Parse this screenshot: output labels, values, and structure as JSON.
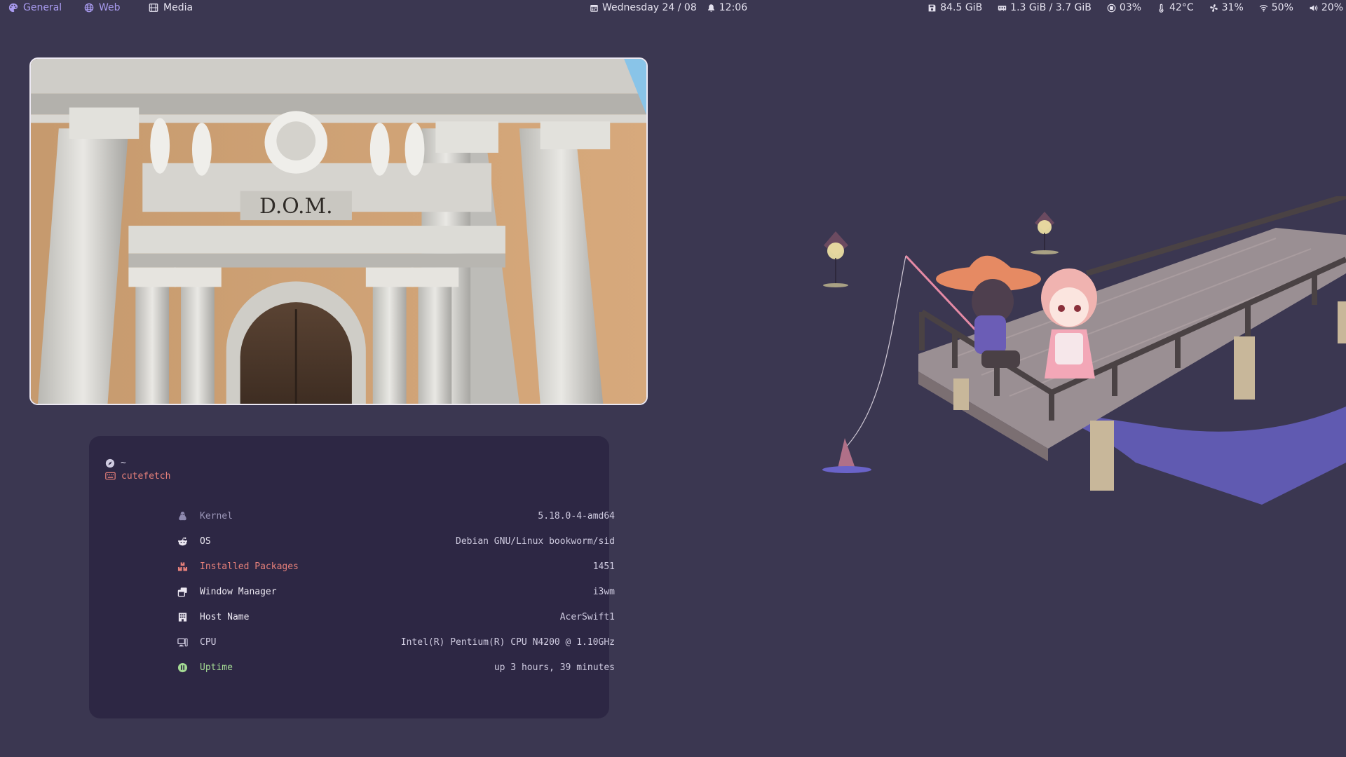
{
  "topbar": {
    "workspaces": [
      {
        "label": "General",
        "icon": "palette-icon",
        "active": true
      },
      {
        "label": "Web",
        "icon": "globe-icon",
        "active": true
      },
      {
        "label": "Media",
        "icon": "film-icon",
        "active": false
      }
    ],
    "date": "Wednesday 24 / 08",
    "time": "12:06",
    "disk": "84.5 GiB",
    "memory": "1.3 GiB / 3.7 GiB",
    "cpu": "03%",
    "temperature": "42°C",
    "fan": "31%",
    "wifi": "50%",
    "volume": "20%"
  },
  "terminal": {
    "directory": "~",
    "command": "cutefetch",
    "rows": [
      {
        "key": "Kernel",
        "value": "5.18.0-4-amd64",
        "icon": "linux-icon"
      },
      {
        "key": "OS",
        "value": "Debian GNU/Linux bookworm/sid",
        "icon": "reddit-icon"
      },
      {
        "key": "Installed Packages",
        "value": "1451",
        "icon": "boxes-icon"
      },
      {
        "key": "Window Manager",
        "value": "i3wm",
        "icon": "windows-stack-icon"
      },
      {
        "key": "Host Name",
        "value": "AcerSwift1",
        "icon": "building-icon"
      },
      {
        "key": "CPU",
        "value": "Intel(R) Pentium(R) CPU N4200 @ 1.10GHz",
        "icon": "computer-icon"
      },
      {
        "key": "Uptime",
        "value": "up 3 hours, 39 minutes",
        "icon": "pause-circle-icon"
      }
    ]
  },
  "photo": {
    "inscription": "D.O.M."
  },
  "colors": {
    "background": "#3b3751",
    "accent": "#a99bf0",
    "terminal_bg": "#2d2744",
    "red": "#e6807a",
    "green": "#a3d993"
  }
}
